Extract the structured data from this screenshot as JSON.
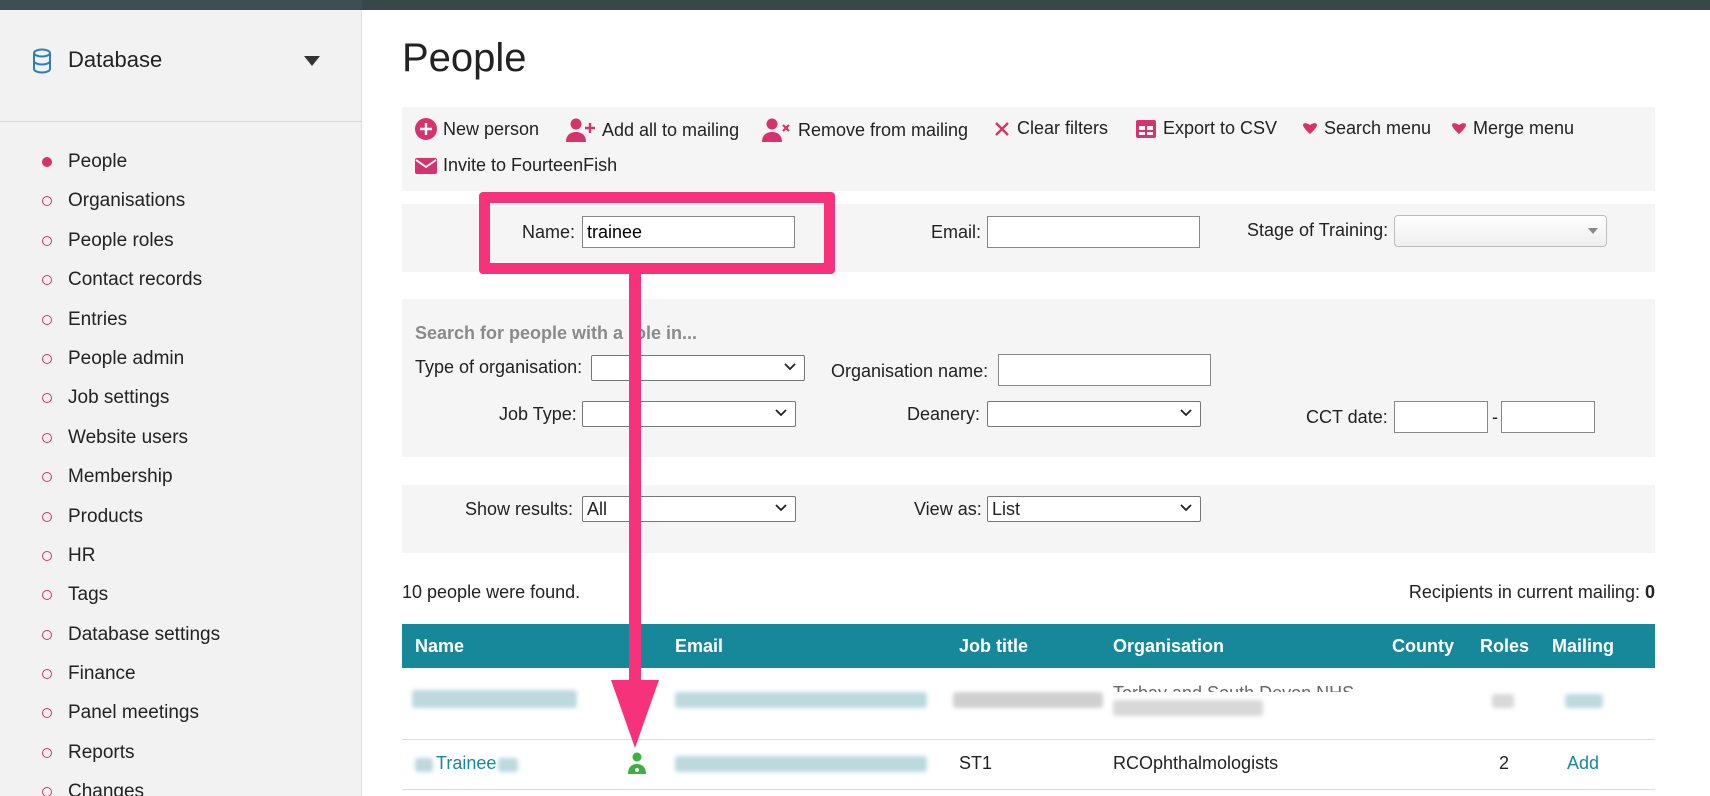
{
  "sidebar": {
    "section_label": "Database",
    "items": [
      {
        "label": "People",
        "active": true
      },
      {
        "label": "Organisations"
      },
      {
        "label": "People roles"
      },
      {
        "label": "Contact records"
      },
      {
        "label": "Entries"
      },
      {
        "label": "People admin"
      },
      {
        "label": "Job settings"
      },
      {
        "label": "Website users"
      },
      {
        "label": "Membership"
      },
      {
        "label": "Products"
      },
      {
        "label": "HR"
      },
      {
        "label": "Tags"
      },
      {
        "label": "Database settings"
      },
      {
        "label": "Finance"
      },
      {
        "label": "Panel meetings"
      },
      {
        "label": "Reports"
      },
      {
        "label": "Changes"
      }
    ]
  },
  "page": {
    "title": "People"
  },
  "toolbar": {
    "new_person": "New person",
    "add_all": "Add all to mailing",
    "remove": "Remove from mailing",
    "clear": "Clear filters",
    "export": "Export to CSV",
    "search_menu": "Search menu",
    "merge_menu": "Merge menu",
    "invite": "Invite to FourteenFish"
  },
  "filters": {
    "name_label": "Name:",
    "name_value": "trainee",
    "email_label": "Email:",
    "email_value": "",
    "stage_label": "Stage of Training:"
  },
  "role_search": {
    "heading": "Search for people with a role in...",
    "type_org_label": "Type of organisation:",
    "org_name_label": "Organisation name:",
    "job_type_label": "Job Type:",
    "deanery_label": "Deanery:",
    "cct_label": "CCT date:",
    "cct_sep": "-"
  },
  "display": {
    "show_label": "Show results:",
    "show_value": "All",
    "view_label": "View as:",
    "view_value": "List"
  },
  "results": {
    "found": "10 people were found.",
    "recipients_label": "Recipients in current mailing:",
    "recipients_count": "0"
  },
  "table": {
    "headers": [
      "Name",
      "Email",
      "Job title",
      "Organisation",
      "County",
      "Roles",
      "Mailing"
    ],
    "row1": {
      "org": "Torbay and South Devon NHS"
    },
    "row2": {
      "name": "Trainee",
      "job": "ST1",
      "org": "RCOphthalmologists",
      "roles": "2",
      "mailing": "Add"
    }
  },
  "colors": {
    "accent": "#d6336c",
    "teal": "#17889a",
    "highlight": "#f5327a"
  }
}
